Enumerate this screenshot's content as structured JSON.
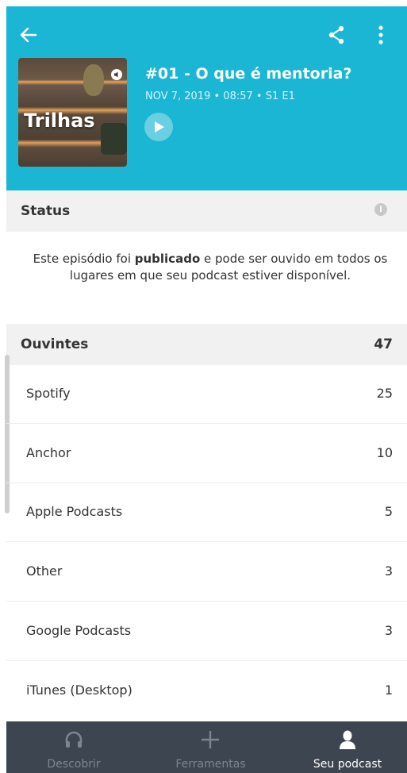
{
  "colors": {
    "header": "#1bb6d3",
    "nav_background": "#3d4650",
    "nav_inactive": "#7d8590",
    "nav_active": "#ffffff"
  },
  "header": {
    "back_icon": "arrow-left-icon",
    "share_icon": "share-icon",
    "more_icon": "more-vertical-icon",
    "cover_text": "Trilhas",
    "title": "#01 - O que é mentoria?",
    "meta": "NOV 7, 2019 • 08:57 • S1 E1",
    "play_icon": "play-icon"
  },
  "status": {
    "title": "Status",
    "info_icon": "info-icon",
    "text_before": "Este episódio foi ",
    "text_bold": "publicado",
    "text_after": " e pode ser ouvido em todos os lugares em que seu podcast estiver disponível."
  },
  "listeners": {
    "title": "Ouvintes",
    "total": "47",
    "rows": [
      {
        "label": "Spotify",
        "value": "25"
      },
      {
        "label": "Anchor",
        "value": "10"
      },
      {
        "label": "Apple Podcasts",
        "value": "5"
      },
      {
        "label": "Other",
        "value": "3"
      },
      {
        "label": "Google Podcasts",
        "value": "3"
      },
      {
        "label": "iTunes (Desktop)",
        "value": "1"
      }
    ]
  },
  "bottom_nav": {
    "items": [
      {
        "label": "Descobrir",
        "icon": "headphones-icon",
        "active": false
      },
      {
        "label": "Ferramentas",
        "icon": "plus-icon",
        "active": false
      },
      {
        "label": "Seu podcast",
        "icon": "user-icon",
        "active": true
      }
    ]
  }
}
